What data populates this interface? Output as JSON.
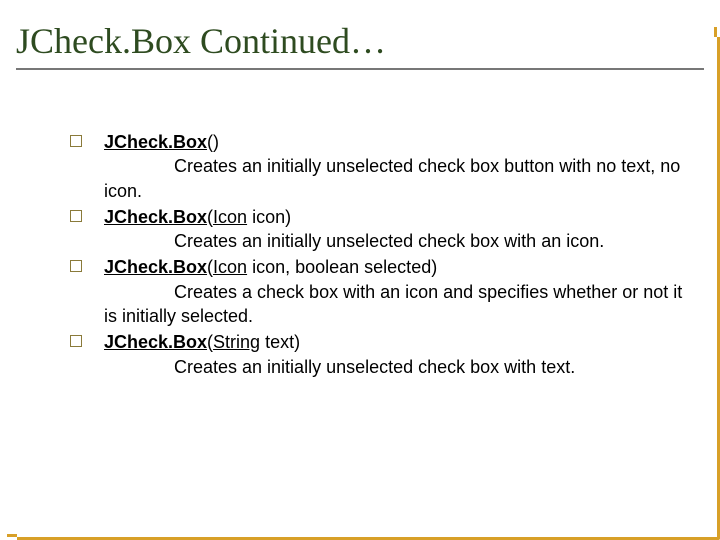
{
  "title": "JCheck.Box Continued…",
  "items": [
    {
      "method": "JCheck.Box",
      "params_prefix": "(",
      "type_link": "",
      "params_suffix": ")",
      "desc": "Creates an initially unselected check box button with no text, no icon."
    },
    {
      "method": "JCheck.Box",
      "params_prefix": "(",
      "type_link": "Icon",
      "params_suffix": " icon)",
      "desc": "Creates an initially unselected check box with an icon."
    },
    {
      "method": "JCheck.Box",
      "params_prefix": "(",
      "type_link": "Icon",
      "params_suffix": " icon, boolean selected)",
      "desc": "Creates a check box with an icon and specifies whether or not it is initially selected."
    },
    {
      "method": "JCheck.Box",
      "params_prefix": "(",
      "type_link": "String",
      "params_suffix": " text)",
      "desc": "Creates an initially unselected check box with text."
    }
  ]
}
